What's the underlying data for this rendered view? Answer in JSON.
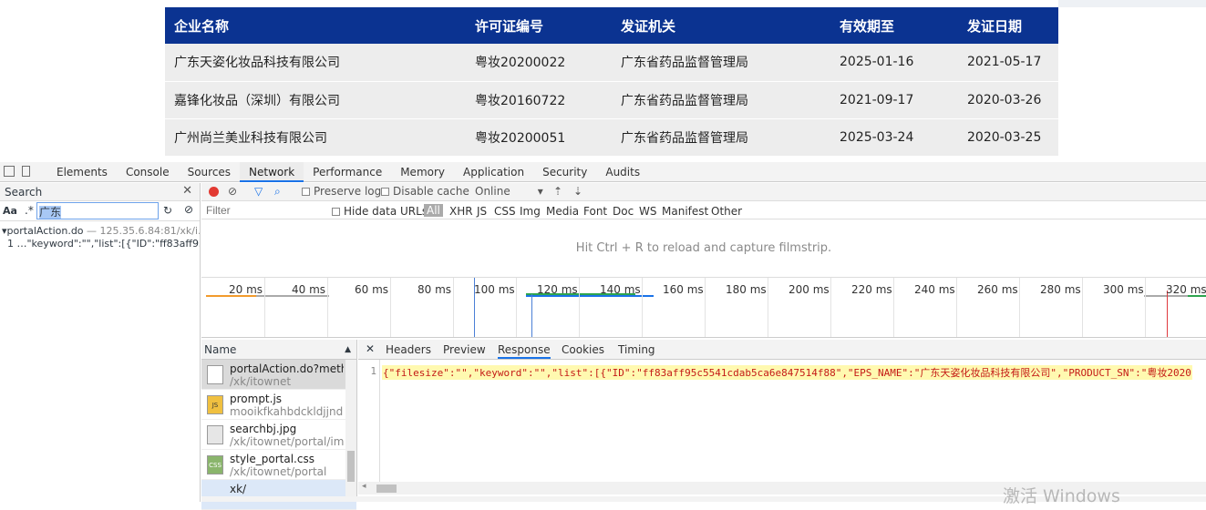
{
  "table": {
    "headers": [
      "企业名称",
      "许可证编号",
      "发证机关",
      "有效期至",
      "发证日期"
    ],
    "rows": [
      [
        "广东天姿化妆品科技有限公司",
        "粤妆20200022",
        "广东省药品监督管理局",
        "2025-01-16",
        "2021-05-17"
      ],
      [
        "嘉锋化妆品（深圳）有限公司",
        "粤妆20160722",
        "广东省药品监督管理局",
        "2021-09-17",
        "2020-03-26"
      ],
      [
        "广州尚兰美业科技有限公司",
        "粤妆20200051",
        "广东省药品监督管理局",
        "2025-03-24",
        "2020-03-25"
      ]
    ]
  },
  "devtools": {
    "tabs": [
      "Elements",
      "Console",
      "Sources",
      "Network",
      "Performance",
      "Memory",
      "Application",
      "Security",
      "Audits"
    ],
    "active_tab": "Network",
    "search": {
      "title": "Search",
      "aa": "Aa",
      "regex": ".*",
      "query": "广东",
      "result_file": "portalAction.do",
      "result_url": " — 125.35.6.84:81/xk/i...",
      "result_line_no": "1",
      "result_line": "…\"keyword\":\"\",\"list\":[{\"ID\":\"ff83aff95..."
    },
    "toolbar": {
      "preserve_log": "Preserve log",
      "disable_cache": "Disable cache",
      "throttle": "Online"
    },
    "filter": {
      "placeholder": "Filter",
      "hide_data_urls": "Hide data URLs",
      "types": [
        "All",
        "XHR",
        "JS",
        "CSS",
        "Img",
        "Media",
        "Font",
        "Doc",
        "WS",
        "Manifest",
        "Other"
      ]
    },
    "filmstrip_hint": "Hit Ctrl + R to reload and capture filmstrip.",
    "timeline_ticks": [
      "20 ms",
      "40 ms",
      "60 ms",
      "80 ms",
      "100 ms",
      "120 ms",
      "140 ms",
      "160 ms",
      "180 ms",
      "200 ms",
      "220 ms",
      "240 ms",
      "260 ms",
      "280 ms",
      "300 ms",
      "320 ms"
    ],
    "requests_header": "Name",
    "requests": [
      {
        "name": "portalAction.do?metho...",
        "path": "/xk/itownet"
      },
      {
        "name": "prompt.js",
        "path": "mooikfkahbdckldjjndioa"
      },
      {
        "name": "searchbj.jpg",
        "path": "/xk/itownet/portal/imag"
      },
      {
        "name": "style_portal.css",
        "path": "/xk/itownet/portal"
      },
      {
        "name": "xk/",
        "path": ""
      }
    ],
    "detail_tabs": [
      "Headers",
      "Preview",
      "Response",
      "Cookies",
      "Timing"
    ],
    "active_detail_tab": "Response",
    "response_line_no": "1",
    "response_text": "{\"filesize\":\"\",\"keyword\":\"\",\"list\":[{\"ID\":\"ff83aff95c5541cdab5ca6e847514f88\",\"EPS_NAME\":\"广东天姿化妆品科技有限公司\",\"PRODUCT_SN\":\"粤妆2020"
  },
  "watermark": "激活 Windows"
}
